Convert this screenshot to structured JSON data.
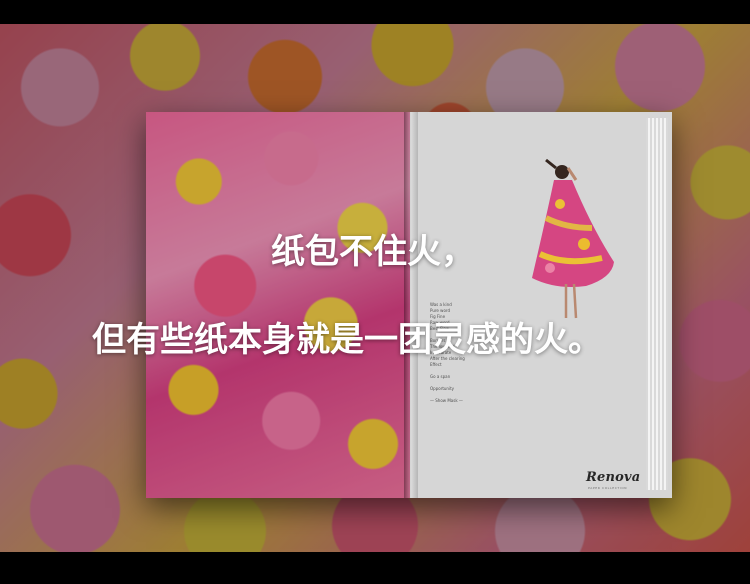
{
  "caption": {
    "line1": "纸包不住火，",
    "line2": "但有些纸本身就是一团灵感的火。"
  },
  "magazine": {
    "copy_lines": [
      "Was a kind",
      "Pure word",
      "Fig Fine",
      "Raw word",
      "Best Flow",
      "",
      "Borders",
      "The lowered",
      "Inaccurate",
      "After the clearing",
      "Effect",
      "",
      "Go a span",
      "",
      "Opportunity",
      "",
      "— Show Mask —"
    ],
    "brand": "Renova",
    "brand_sub": "PAPER COLLECTION"
  },
  "colors": {
    "background": "#000000",
    "caption_text": "#ffffff",
    "page_right": "#e9e9e9"
  }
}
